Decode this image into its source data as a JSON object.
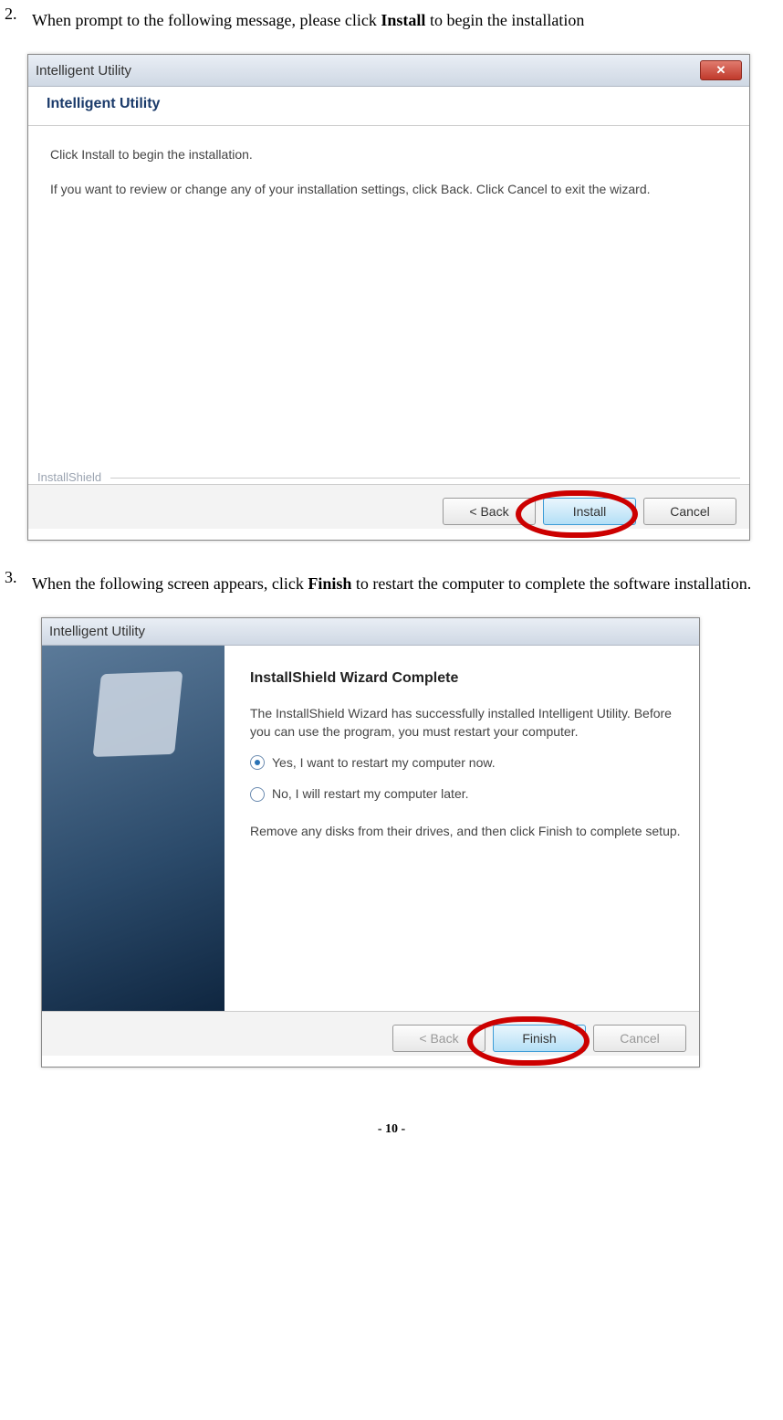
{
  "step2": {
    "num": "2.",
    "text_before": "When prompt to the following message, please click ",
    "bold": "Install",
    "text_after": " to begin the installation"
  },
  "step3": {
    "num": "3.",
    "text_before": "When the following screen appears, click ",
    "bold": "Finish",
    "text_after": " to restart the computer to complete the software installation."
  },
  "dialog1": {
    "title": "Intelligent Utility",
    "header": "Intelligent Utility",
    "line1": "Click Install to begin the installation.",
    "line2": "If you want to review or change any of your installation settings, click Back. Click Cancel to exit the wizard.",
    "installshield": "InstallShield",
    "back": "< Back",
    "install": "Install",
    "cancel": "Cancel"
  },
  "dialog2": {
    "title": "Intelligent Utility",
    "heading": "InstallShield Wizard Complete",
    "para": "The InstallShield Wizard has successfully installed Intelligent Utility.  Before you can use the program, you must restart your computer.",
    "opt_yes": "Yes, I want to restart my computer now.",
    "opt_no": "No, I will restart my computer later.",
    "remove": "Remove any disks from their drives, and then click Finish to complete setup.",
    "back": "< Back",
    "finish": "Finish",
    "cancel": "Cancel"
  },
  "footer": "- 10 -"
}
